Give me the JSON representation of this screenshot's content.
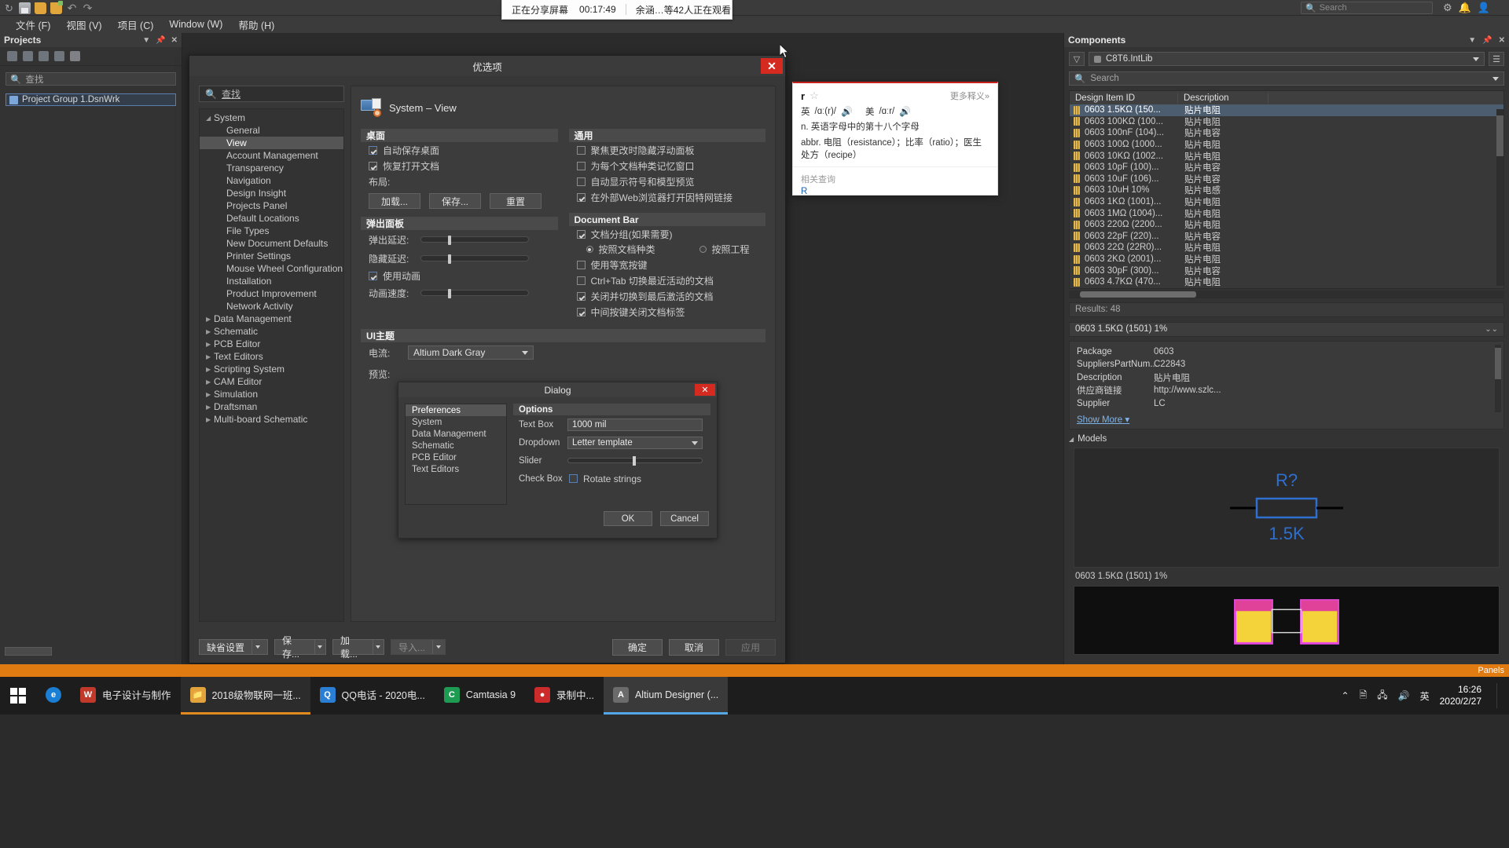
{
  "app": {
    "toolbar_icons": [
      "refresh-icon",
      "save-icon",
      "open-folder-icon",
      "open-project-icon",
      "undo-icon",
      "redo-icon"
    ],
    "menu": [
      {
        "label": "文件 (F)"
      },
      {
        "label": "视图 (V)"
      },
      {
        "label": "项目 (C)"
      },
      {
        "label": "Window (W)"
      },
      {
        "label": "帮助 (H)"
      }
    ],
    "top_search_placeholder": "Search",
    "top_right_icons": [
      "gear-icon",
      "bell-icon",
      "user-icon"
    ]
  },
  "share_banner": {
    "status": "正在分享屏幕",
    "timer": "00:17:49",
    "watchers": "余涵…等42人正在观看"
  },
  "projects_panel": {
    "title": "Projects",
    "search_placeholder": "查找",
    "items": [
      {
        "label": "Project Group 1.DsnWrk"
      }
    ]
  },
  "preferences": {
    "title": "优选项",
    "close_label": "✕",
    "tree_search_placeholder": "查找",
    "tree": [
      {
        "label": "System",
        "level": 0,
        "expanded": true,
        "selected": false
      },
      {
        "label": "General",
        "level": 1,
        "selected": false
      },
      {
        "label": "View",
        "level": 1,
        "selected": true
      },
      {
        "label": "Account Management",
        "level": 1,
        "selected": false
      },
      {
        "label": "Transparency",
        "level": 1,
        "selected": false
      },
      {
        "label": "Navigation",
        "level": 1,
        "selected": false
      },
      {
        "label": "Design Insight",
        "level": 1,
        "selected": false
      },
      {
        "label": "Projects Panel",
        "level": 1,
        "selected": false
      },
      {
        "label": "Default Locations",
        "level": 1,
        "selected": false
      },
      {
        "label": "File Types",
        "level": 1,
        "selected": false
      },
      {
        "label": "New Document Defaults",
        "level": 1,
        "selected": false
      },
      {
        "label": "Printer Settings",
        "level": 1,
        "selected": false
      },
      {
        "label": "Mouse Wheel Configuration",
        "level": 1,
        "selected": false
      },
      {
        "label": "Installation",
        "level": 1,
        "selected": false
      },
      {
        "label": "Product Improvement",
        "level": 1,
        "selected": false
      },
      {
        "label": "Network Activity",
        "level": 1,
        "selected": false
      },
      {
        "label": "Data Management",
        "level": 0,
        "expanded": false,
        "selected": false
      },
      {
        "label": "Schematic",
        "level": 0,
        "expanded": false,
        "selected": false
      },
      {
        "label": "PCB Editor",
        "level": 0,
        "expanded": false,
        "selected": false
      },
      {
        "label": "Text Editors",
        "level": 0,
        "expanded": false,
        "selected": false
      },
      {
        "label": "Scripting System",
        "level": 0,
        "expanded": false,
        "selected": false
      },
      {
        "label": "CAM Editor",
        "level": 0,
        "expanded": false,
        "selected": false
      },
      {
        "label": "Simulation",
        "level": 0,
        "expanded": false,
        "selected": false
      },
      {
        "label": "Draftsman",
        "level": 0,
        "expanded": false,
        "selected": false
      },
      {
        "label": "Multi-board Schematic",
        "level": 0,
        "expanded": false,
        "selected": false
      }
    ],
    "page_title": "System – View",
    "sections": {
      "desktop": {
        "heading": "桌面",
        "checkboxes": [
          {
            "label": "自动保存桌面",
            "checked": true
          },
          {
            "label": "恢复打开文档",
            "checked": true
          }
        ],
        "layout_label": "布局:",
        "buttons": [
          "加载...",
          "保存...",
          "重置"
        ]
      },
      "popup_panels": {
        "heading": "弹出面板",
        "popup_delay_label": "弹出延迟:",
        "hide_delay_label": "隐藏延迟:",
        "animation_label": "使用动画",
        "animation_checked": true,
        "animation_speed_label": "动画速度:",
        "popup_delay_value": 27,
        "hide_delay_value": 27,
        "animation_speed_value": 27
      },
      "general": {
        "heading": "通用",
        "checkboxes": [
          {
            "label": "聚焦更改时隐藏浮动面板",
            "checked": false
          },
          {
            "label": "为每个文档种类记忆窗口",
            "checked": false
          },
          {
            "label": "自动显示符号和模型预览",
            "checked": false
          },
          {
            "label": "在外部Web浏览器打开因特网链接",
            "checked": true
          }
        ]
      },
      "document_bar": {
        "heading": "Document Bar",
        "group_label": "文档分组(如果需要)",
        "group_checked": true,
        "radio_by_type": "按照文档种类",
        "radio_by_project": "按照工程",
        "radio_selected": "按照文档种类",
        "checkboxes": [
          {
            "label": "使用等宽按键",
            "checked": false
          },
          {
            "label": "Ctrl+Tab 切换最近活动的文档",
            "checked": false
          },
          {
            "label": "关闭并切换到最后激活的文档",
            "checked": true
          },
          {
            "label": "中间按键关闭文档标签",
            "checked": true
          }
        ]
      },
      "ui_theme": {
        "heading": "UI主题",
        "current_label": "电流:",
        "current_value": "Altium Dark Gray",
        "preview_label": "预览:"
      }
    },
    "dialog_preview": {
      "title": "Dialog",
      "close_label": "✕",
      "nav_items": [
        "Preferences",
        "System",
        "Data Management",
        "Schematic",
        "PCB Editor",
        "Text Editors"
      ],
      "nav_selected": "Preferences",
      "options_heading": "Options",
      "fields": [
        {
          "label": "Text Box",
          "value": "1000 mil",
          "type": "text"
        },
        {
          "label": "Dropdown",
          "value": "Letter template",
          "type": "select"
        },
        {
          "label": "Slider",
          "value": "",
          "type": "slider"
        },
        {
          "label": "Check Box",
          "value": "Rotate strings",
          "type": "checkbox",
          "checked": false
        }
      ],
      "ok_label": "OK",
      "cancel_label": "Cancel"
    },
    "footer": {
      "defaults_label": "缺省设置",
      "save_label": "保存...",
      "load_label": "加载...",
      "import_label": "导入...",
      "ok_label": "确定",
      "cancel_label": "取消",
      "apply_label": "应用"
    }
  },
  "dictionary": {
    "word": "r",
    "more_label": "更多释义»",
    "uk_label": "英",
    "uk_phonetic": "/ɑː(r)/",
    "us_label": "美",
    "us_phonetic": "/ɑːr/",
    "definitions": [
      "n. 英语字母中的第十八个字母",
      "abbr. 电阻（resistance）；比率（ratio）；医生处方（recipe）"
    ],
    "related_label": "相关查询",
    "related_word": "R"
  },
  "components_panel": {
    "title": "Components",
    "library": "C8T6.IntLib",
    "search_placeholder": "Search",
    "columns": [
      "Design Item ID",
      "Description"
    ],
    "rows": [
      {
        "id": "0603 1.5KΩ (150...",
        "desc": "贴片电阻",
        "selected": true
      },
      {
        "id": "0603 100KΩ (100...",
        "desc": "贴片电阻",
        "selected": false
      },
      {
        "id": "0603 100nF (104)...",
        "desc": "贴片电容",
        "selected": false
      },
      {
        "id": "0603 100Ω (1000...",
        "desc": "贴片电阻",
        "selected": false
      },
      {
        "id": "0603 10KΩ (1002...",
        "desc": "贴片电阻",
        "selected": false
      },
      {
        "id": "0603 10pF (100)...",
        "desc": "贴片电容",
        "selected": false
      },
      {
        "id": "0603 10uF (106)...",
        "desc": "贴片电容",
        "selected": false
      },
      {
        "id": "0603 10uH 10%",
        "desc": "贴片电感",
        "selected": false
      },
      {
        "id": "0603 1KΩ (1001)...",
        "desc": "贴片电阻",
        "selected": false
      },
      {
        "id": "0603 1MΩ (1004)...",
        "desc": "贴片电阻",
        "selected": false
      },
      {
        "id": "0603 220Ω (2200...",
        "desc": "贴片电阻",
        "selected": false
      },
      {
        "id": "0603 22pF (220)...",
        "desc": "贴片电容",
        "selected": false
      },
      {
        "id": "0603 22Ω (22R0)...",
        "desc": "贴片电阻",
        "selected": false
      },
      {
        "id": "0603 2KΩ (2001)...",
        "desc": "贴片电阻",
        "selected": false
      },
      {
        "id": "0603 30pF (300)...",
        "desc": "贴片电容",
        "selected": false
      },
      {
        "id": "0603 4.7KΩ (470...",
        "desc": "贴片电阻",
        "selected": false
      }
    ],
    "results": "Results: 48",
    "detail_title": "0603 1.5KΩ (1501) 1%",
    "properties": [
      {
        "key": "Package",
        "value": "0603"
      },
      {
        "key": "SuppliersPartNum...",
        "value": "C22843"
      },
      {
        "key": "Description",
        "value": "贴片电阻"
      },
      {
        "key": "供应商链接",
        "value": "http://www.szlc..."
      },
      {
        "key": "Supplier",
        "value": "LC"
      }
    ],
    "show_more": "Show More",
    "models_label": "Models",
    "model_designator": "R?",
    "model_value": "1.5K",
    "model_caption": "0603 1.5KΩ (1501) 1%"
  },
  "taskbar": {
    "items": [
      {
        "label": "电子设计与制作",
        "icon": "word-icon",
        "state": "normal"
      },
      {
        "label": "2018级物联网一班...",
        "icon": "explorer-icon",
        "state": "running"
      },
      {
        "label": "QQ电话 - 2020电...",
        "icon": "qq-icon",
        "state": "normal"
      },
      {
        "label": "Camtasia 9",
        "icon": "camtasia-icon",
        "state": "normal"
      },
      {
        "label": "录制中...",
        "icon": "record-icon",
        "state": "normal"
      },
      {
        "label": "Altium Designer (...",
        "icon": "altium-icon",
        "state": "active"
      }
    ],
    "tray_icons": [
      "chevron-up-icon",
      "battery-icon",
      "network-icon",
      "volume-icon"
    ],
    "ime": "英",
    "time": "16:26",
    "date": "2020/2/27"
  },
  "statusbar": {
    "panels_label": "Panels"
  }
}
